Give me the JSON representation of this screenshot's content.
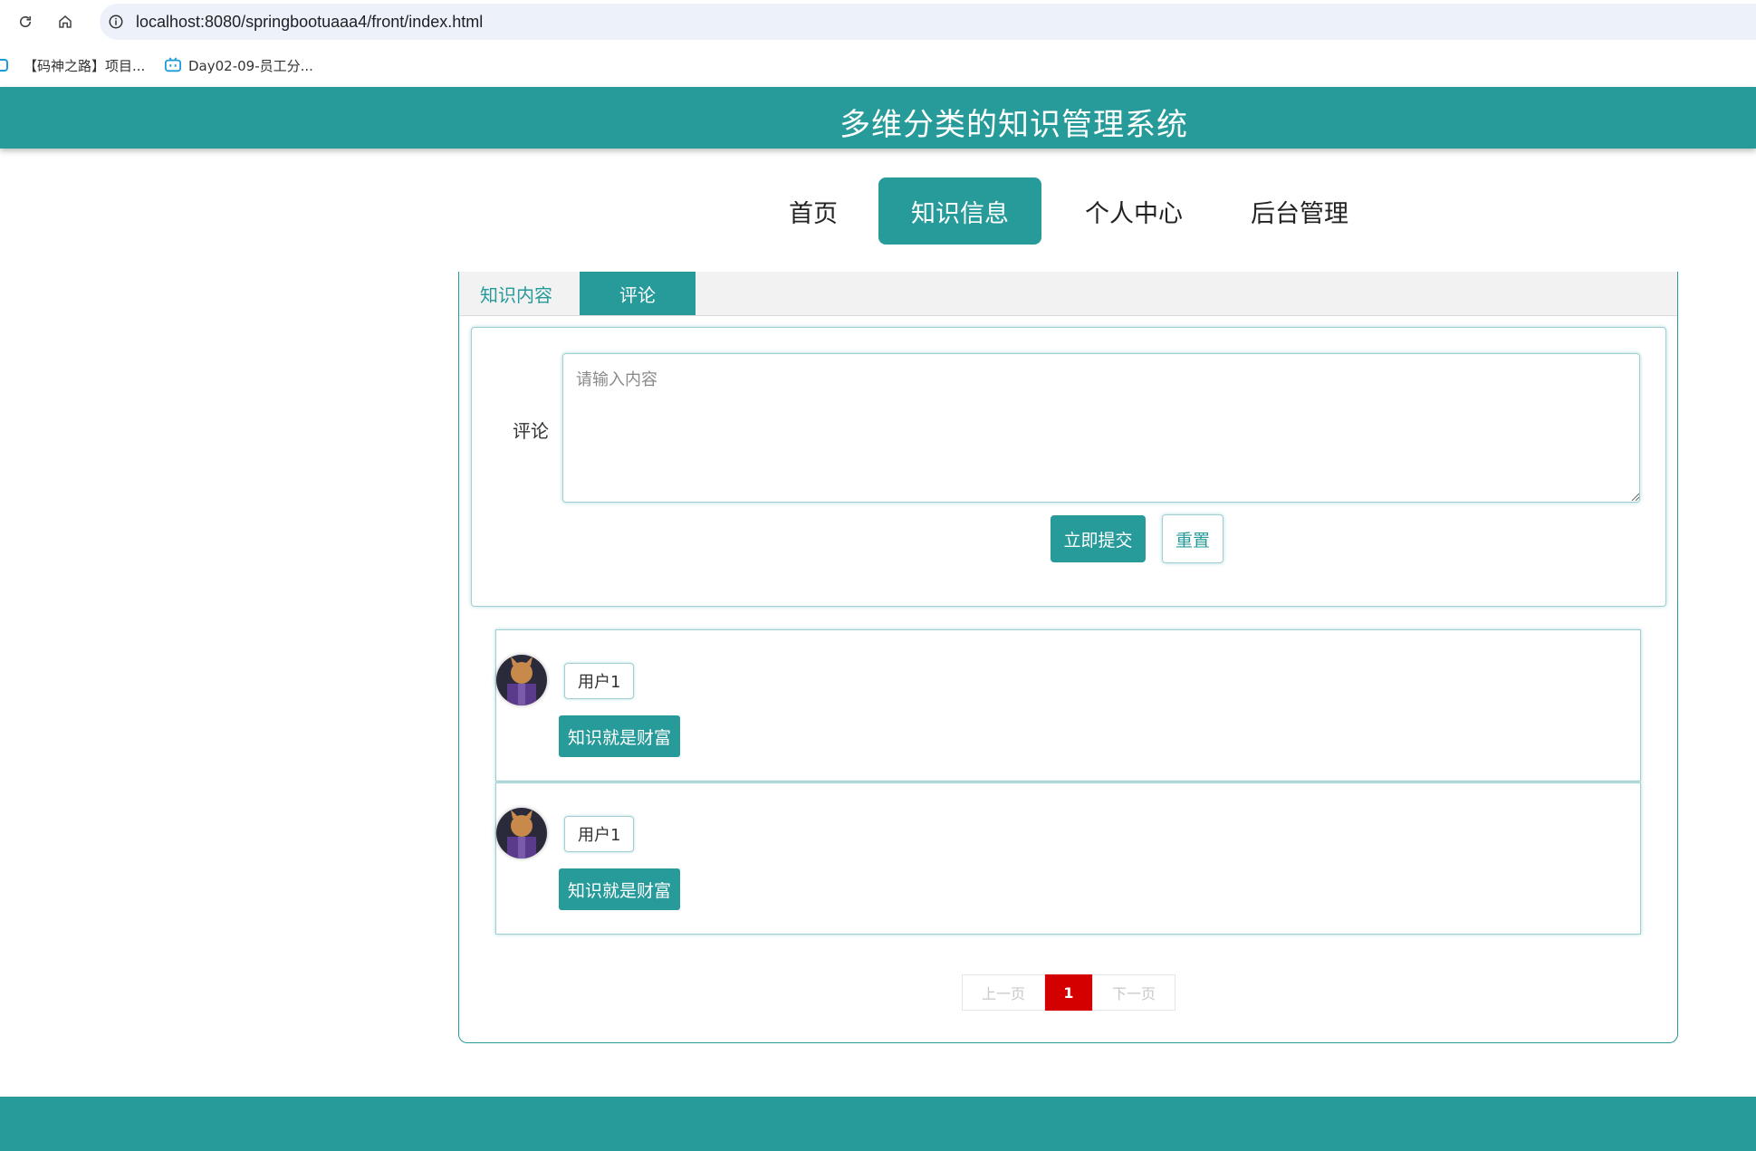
{
  "browser": {
    "url": "localhost:8080/springbootuaaa4/front/index.html",
    "bookmarks": [
      {
        "label": "【码神之路】项目..."
      },
      {
        "label": "Day02-09-员工分..."
      }
    ]
  },
  "header": {
    "title": "多维分类的知识管理系统"
  },
  "nav": {
    "items": [
      {
        "label": "首页"
      },
      {
        "label": "知识信息"
      },
      {
        "label": "个人中心"
      },
      {
        "label": "后台管理"
      }
    ],
    "active": "知识信息"
  },
  "tabs": [
    {
      "label": "知识内容"
    },
    {
      "label": "评论"
    }
  ],
  "comment_form": {
    "label": "评论",
    "placeholder": "请输入内容",
    "submit_label": "立即提交",
    "reset_label": "重置"
  },
  "comments": [
    {
      "user": "用户1",
      "content": "知识就是财富"
    },
    {
      "user": "用户1",
      "content": "知识就是财富"
    }
  ],
  "pagination": {
    "prev_label": "上一页",
    "current_page": "1",
    "next_label": "下一页"
  },
  "colors": {
    "primary": "#279a9a",
    "current_page": "#d40000"
  }
}
